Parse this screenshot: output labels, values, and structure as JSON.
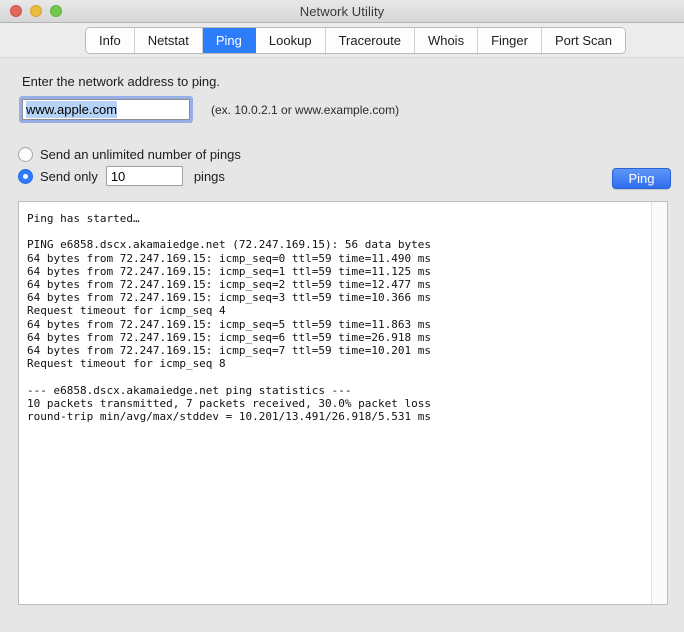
{
  "window": {
    "title": "Network Utility",
    "traffic_lights": [
      {
        "name": "close",
        "color": "#e0695e"
      },
      {
        "name": "minimize",
        "color": "#e9bc40"
      },
      {
        "name": "maximize",
        "color": "#73c94d"
      }
    ]
  },
  "tabs": [
    {
      "label": "Info",
      "active": false
    },
    {
      "label": "Netstat",
      "active": false
    },
    {
      "label": "Ping",
      "active": true
    },
    {
      "label": "Lookup",
      "active": false
    },
    {
      "label": "Traceroute",
      "active": false
    },
    {
      "label": "Whois",
      "active": false
    },
    {
      "label": "Finger",
      "active": false
    },
    {
      "label": "Port Scan",
      "active": false
    }
  ],
  "form": {
    "prompt_label": "Enter the network address to ping.",
    "address_value": "www.apple.com",
    "address_placeholder": "www.example.com",
    "address_hint": "(ex. 10.0.2.1 or www.example.com)",
    "unlimited_label": "Send an unlimited number of pings",
    "unlimited_selected": false,
    "send_only_label": "Send only",
    "send_only_selected": true,
    "ping_count_value": "10",
    "pings_label": "pings",
    "ping_button_label": "Ping"
  },
  "colors": {
    "accent": "#2d7cfb",
    "window_bg": "#e6e6e6",
    "selection": "#b6d3f7"
  },
  "output": {
    "text": "Ping has started…\n\nPING e6858.dscx.akamaiedge.net (72.247.169.15): 56 data bytes\n64 bytes from 72.247.169.15: icmp_seq=0 ttl=59 time=11.490 ms\n64 bytes from 72.247.169.15: icmp_seq=1 ttl=59 time=11.125 ms\n64 bytes from 72.247.169.15: icmp_seq=2 ttl=59 time=12.477 ms\n64 bytes from 72.247.169.15: icmp_seq=3 ttl=59 time=10.366 ms\nRequest timeout for icmp_seq 4\n64 bytes from 72.247.169.15: icmp_seq=5 ttl=59 time=11.863 ms\n64 bytes from 72.247.169.15: icmp_seq=6 ttl=59 time=26.918 ms\n64 bytes from 72.247.169.15: icmp_seq=7 ttl=59 time=10.201 ms\nRequest timeout for icmp_seq 8\n\n--- e6858.dscx.akamaiedge.net ping statistics ---\n10 packets transmitted, 7 packets received, 30.0% packet loss\nround-trip min/avg/max/stddev = 10.201/13.491/26.918/5.531 ms"
  }
}
